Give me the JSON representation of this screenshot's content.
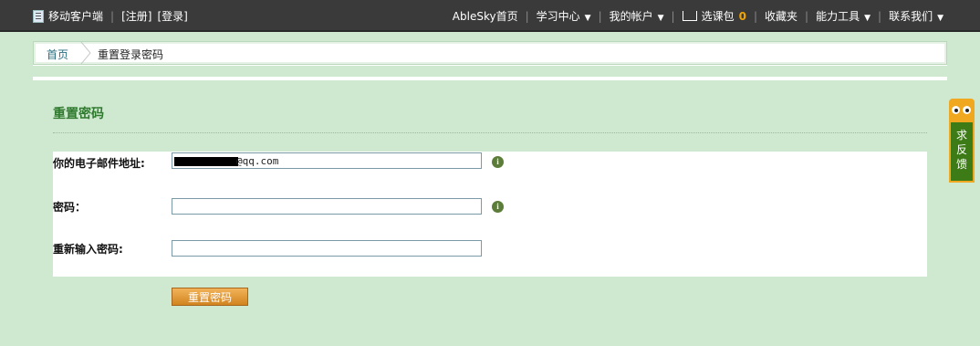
{
  "topbar": {
    "mobile": "移动客户端",
    "register": "[注册]",
    "login": "[登录]",
    "home": "AbleSky首页",
    "learning_center": "学习中心",
    "my_account": "我的帐户",
    "cart_label": "选课包",
    "cart_count": "0",
    "favorites": "收藏夹",
    "tools": "能力工具",
    "contact": "联系我们"
  },
  "breadcrumb": {
    "home": "首页",
    "current": "重置登录密码"
  },
  "form": {
    "title": "重置密码",
    "email_label": "你的电子邮件地址:",
    "email_value": "@qq.com",
    "password_label": "密码：",
    "confirm_label": "重新输入密码:",
    "submit_label": "重置密码"
  },
  "feedback": {
    "label": "求反馈"
  }
}
